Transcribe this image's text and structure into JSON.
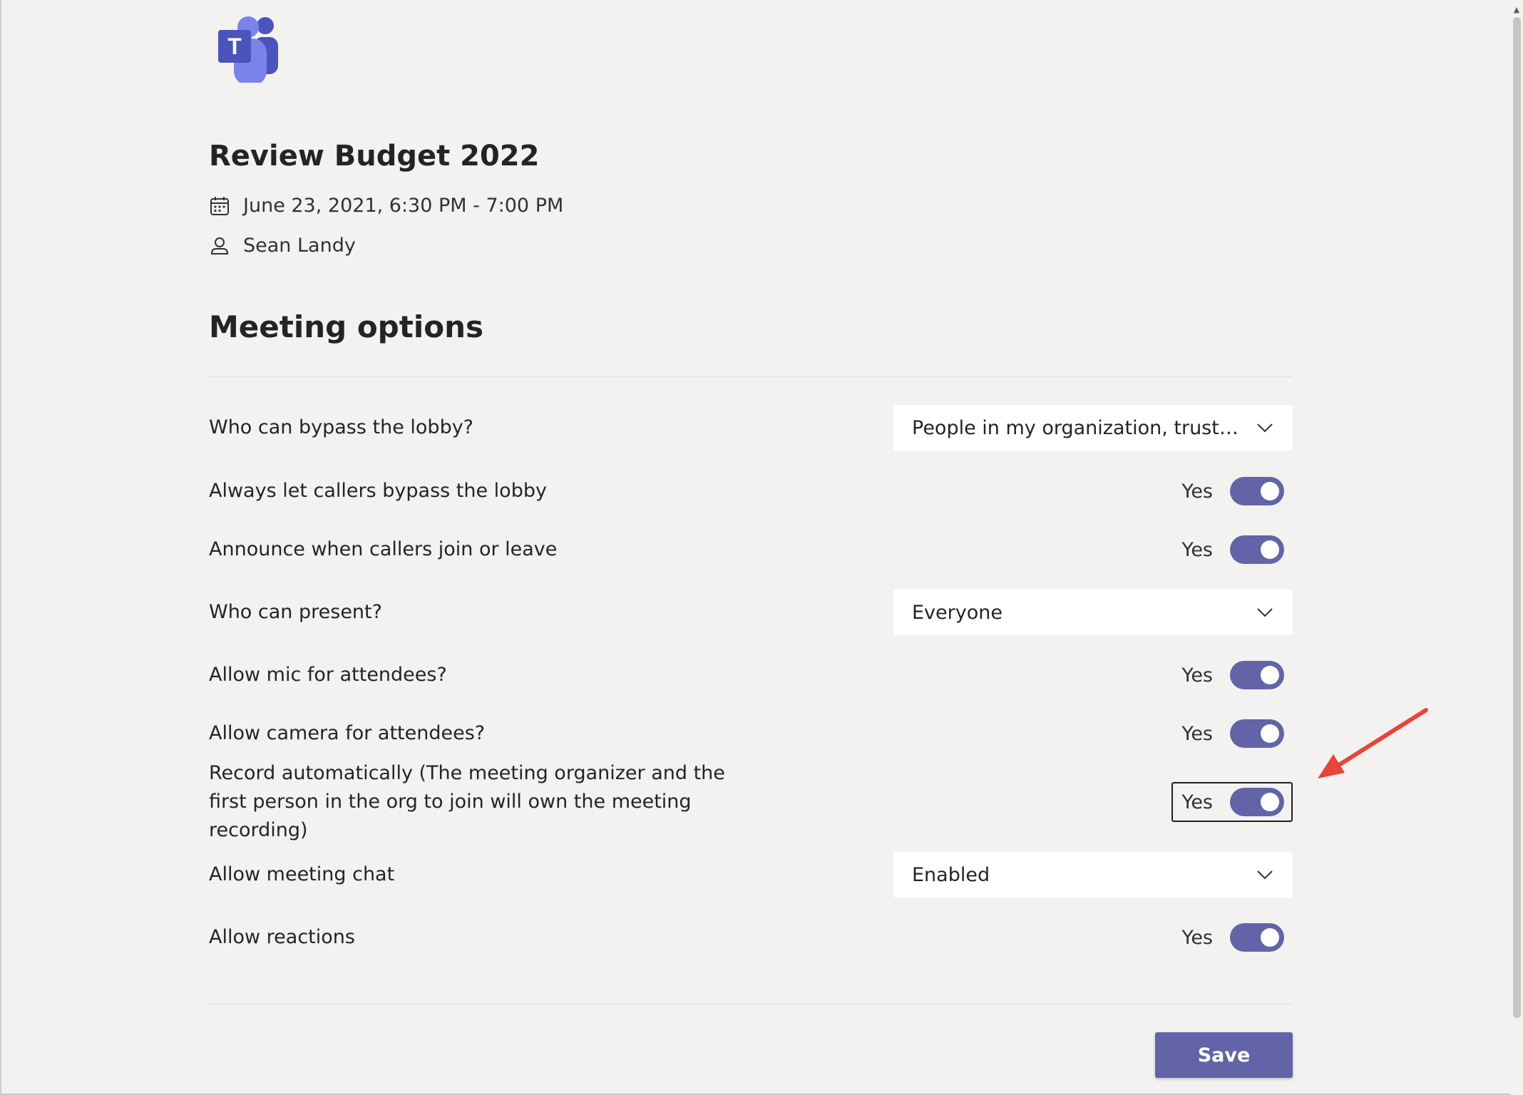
{
  "meeting": {
    "title": "Review Budget 2022",
    "datetime": "June 23, 2021, 6:30 PM - 7:00 PM",
    "organizer": "Sean Landy"
  },
  "logo": {
    "letter": "T",
    "name": "teams-logo"
  },
  "section_title": "Meeting options",
  "options": [
    {
      "label": "Who can bypass the lobby?",
      "type": "dropdown",
      "value": "People in my organization, truste..."
    },
    {
      "label": "Always let callers bypass the lobby",
      "type": "toggle",
      "value": "Yes"
    },
    {
      "label": "Announce when callers join or leave",
      "type": "toggle",
      "value": "Yes"
    },
    {
      "label": "Who can present?",
      "type": "dropdown",
      "value": "Everyone"
    },
    {
      "label": "Allow mic for attendees?",
      "type": "toggle",
      "value": "Yes"
    },
    {
      "label": "Allow camera for attendees?",
      "type": "toggle",
      "value": "Yes"
    },
    {
      "label": "Record automatically (The meeting organizer and the first person in the org to join will own the meeting recording)",
      "type": "toggle",
      "value": "Yes",
      "focused": true
    },
    {
      "label": "Allow meeting chat",
      "type": "dropdown",
      "value": "Enabled"
    },
    {
      "label": "Allow reactions",
      "type": "toggle",
      "value": "Yes"
    }
  ],
  "save_label": "Save",
  "colors": {
    "background": "#f3f2f1",
    "accent": "#6264a7",
    "annotation_arrow": "#e8443a"
  },
  "icons": {
    "date": "calendar-icon",
    "organizer": "person-icon",
    "dropdown": "chevron-down-icon"
  }
}
